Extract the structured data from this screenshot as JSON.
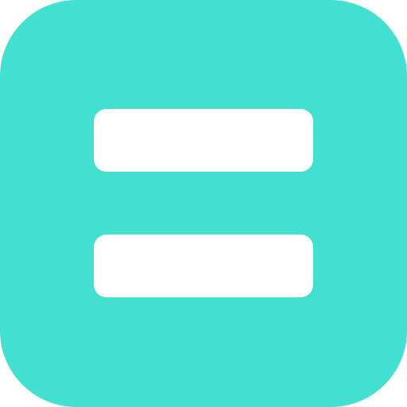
{
  "icon": {
    "name": "equals-icon",
    "background_color": "#42E0D1",
    "bar_color": "#FFFFFF"
  }
}
